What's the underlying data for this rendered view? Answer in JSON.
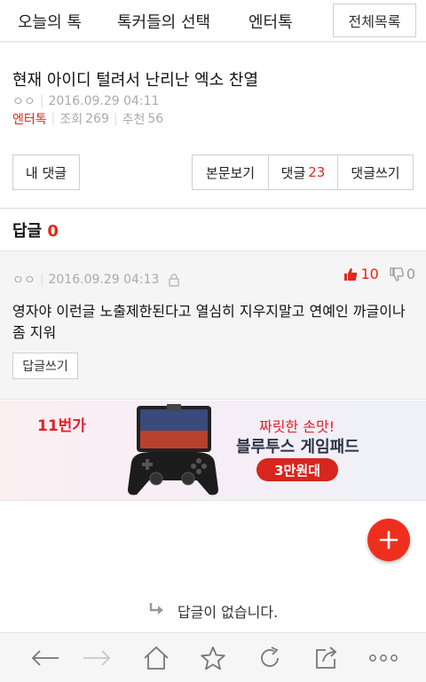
{
  "top_nav": {
    "tabs": [
      "오늘의 톡",
      "톡커들의 선택",
      "엔터톡"
    ],
    "all_list_label": "전체목록"
  },
  "post": {
    "title": "현재 아이디 털려서 난리난 엑소 찬열",
    "author": "ㅇㅇ",
    "datetime": "2016.09.29 04:11",
    "category": "엔터톡",
    "views_label": "조회",
    "views": "269",
    "recommend_label": "추천",
    "recommend": "56"
  },
  "actions": {
    "my_comments": "내 댓글",
    "view_body": "본문보기",
    "comments_label": "댓글",
    "comments_count": "23",
    "write_comment": "댓글쓰기"
  },
  "replies_header": {
    "label": "답글",
    "count": "0"
  },
  "comment": {
    "author": "ㅇㅇ",
    "datetime": "2016.09.29 04:13",
    "text": "영자야 이런글 노출제한된다고 열심히 지우지말고 연예인 까글이나 좀 지워",
    "reply_button": "답글쓰기",
    "likes": "10",
    "dislikes": "0"
  },
  "ad": {
    "brand": "11번가",
    "line1": "짜릿한 손맛!",
    "line2": "블루투스 게임패드",
    "price": "3만원대"
  },
  "no_replies_text": "답글이 없습니다.",
  "colors": {
    "accent": "#e0281a",
    "fab": "#ef2f1e"
  },
  "bottom_bar_icons": [
    "back-icon",
    "forward-icon",
    "home-icon",
    "star-icon",
    "refresh-icon",
    "share-icon",
    "more-icon"
  ]
}
